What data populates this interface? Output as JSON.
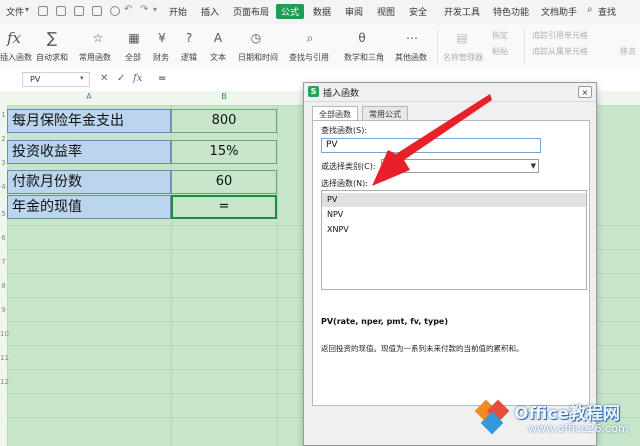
{
  "menubar": {
    "file": "文件",
    "tabs": [
      "开始",
      "插入",
      "页面布局",
      "公式",
      "数据",
      "审阅",
      "视图",
      "安全",
      "开发工具",
      "特色功能",
      "文档助手"
    ],
    "active_tab": "公式",
    "search": "查找"
  },
  "ribbon": {
    "insert_function": "插入函数",
    "autosum": "自动求和",
    "common_functions": "常用函数",
    "all": "全部",
    "finance": "财务",
    "logic": "逻辑",
    "text": "文本",
    "datetime": "日期和时间",
    "lookup": "查找与引用",
    "math": "数学和三角",
    "other": "其他函数",
    "name_manager": "名称管理器",
    "specify": "指定",
    "paste": "粘贴",
    "trace_precedents": "追踪引用单元格",
    "trace_dependents": "追踪从属单元格",
    "remove_arrows": "移去"
  },
  "formulabar": {
    "namebox": "PV",
    "fx": "fx",
    "value": "="
  },
  "grid": {
    "columns": [
      "A",
      "B"
    ],
    "rows": [
      {
        "label": "每月保险年金支出",
        "value": "800"
      },
      {
        "label": "投资收益率",
        "value": "15%"
      },
      {
        "label": "付款月份数",
        "value": "60"
      },
      {
        "label": "年金的现值",
        "value": "="
      }
    ],
    "row_numbers": [
      "1",
      "2",
      "3",
      "4",
      "5",
      "6",
      "7",
      "8",
      "9",
      "10",
      "11",
      "12"
    ]
  },
  "dialog": {
    "title": "插入函数",
    "close": "×",
    "tabs": [
      "全部函数",
      "常用公式"
    ],
    "search_label": "查找函数(S):",
    "search_value": "PV",
    "category_label": "或选择类别(C):",
    "category_value": "推",
    "list_label": "选择函数(N):",
    "functions": [
      "PV",
      "NPV",
      "XNPV"
    ],
    "selected_function": "PV",
    "signature": "PV(rate, nper, pmt, fv, type)",
    "description": "返回投资的现值。现值为一系列未来付款的当前值的累积和。"
  },
  "watermark": {
    "title": "Office教程网",
    "url": "www.office26.com"
  },
  "colors": {
    "accent": "#1f9d55",
    "arrow": "#e8202a",
    "label_fill": "#bcd5ef",
    "grid_fill": "#c7e5c8"
  }
}
